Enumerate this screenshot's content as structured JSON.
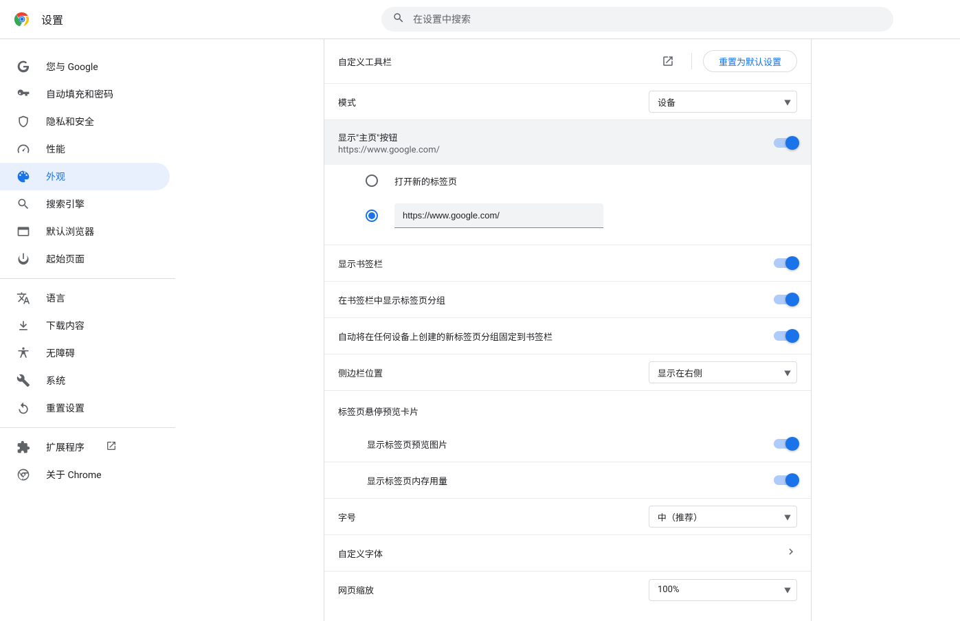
{
  "header": {
    "title": "设置",
    "search_placeholder": "在设置中搜索"
  },
  "sidebar": {
    "items": [
      {
        "id": "you-and-google",
        "label": "您与 Google"
      },
      {
        "id": "autofill",
        "label": "自动填充和密码"
      },
      {
        "id": "privacy",
        "label": "隐私和安全"
      },
      {
        "id": "performance",
        "label": "性能"
      },
      {
        "id": "appearance",
        "label": "外观"
      },
      {
        "id": "search-engine",
        "label": "搜索引擎"
      },
      {
        "id": "default-browser",
        "label": "默认浏览器"
      },
      {
        "id": "on-startup",
        "label": "起始页面"
      }
    ],
    "items2": [
      {
        "id": "languages",
        "label": "语言"
      },
      {
        "id": "downloads",
        "label": "下载内容"
      },
      {
        "id": "accessibility",
        "label": "无障碍"
      },
      {
        "id": "system",
        "label": "系统"
      },
      {
        "id": "reset",
        "label": "重置设置"
      }
    ],
    "items3": [
      {
        "id": "extensions",
        "label": "扩展程序"
      },
      {
        "id": "about",
        "label": "关于 Chrome"
      }
    ]
  },
  "main": {
    "custom_toolbar": "自定义工具栏",
    "reset_default": "重置为默认设置",
    "mode_label": "模式",
    "mode_value": "设备",
    "home_button_label": "显示\"主页\"按钮",
    "home_button_sub": "https://www.google.com/",
    "home_button_on": true,
    "home_radio_newtab": "打开新的标签页",
    "home_radio_custom_value": "https://www.google.com/",
    "home_radio_selected": "custom",
    "bookmarks_bar_label": "显示书签栏",
    "bookmarks_bar_on": true,
    "tab_groups_label": "在书签栏中显示标签页分组",
    "tab_groups_on": true,
    "auto_pin_label": "自动将在任何设备上创建的新标签页分组固定到书签栏",
    "auto_pin_on": true,
    "sidepanel_label": "侧边栏位置",
    "sidepanel_value": "显示在右侧",
    "hover_section": "标签页悬停预览卡片",
    "hover_preview_label": "显示标签页预览图片",
    "hover_preview_on": true,
    "hover_memory_label": "显示标签页内存用量",
    "hover_memory_on": true,
    "font_size_label": "字号",
    "font_size_value": "中（推荐）",
    "custom_fonts_label": "自定义字体",
    "page_zoom_label": "网页缩放",
    "page_zoom_value": "100%"
  }
}
